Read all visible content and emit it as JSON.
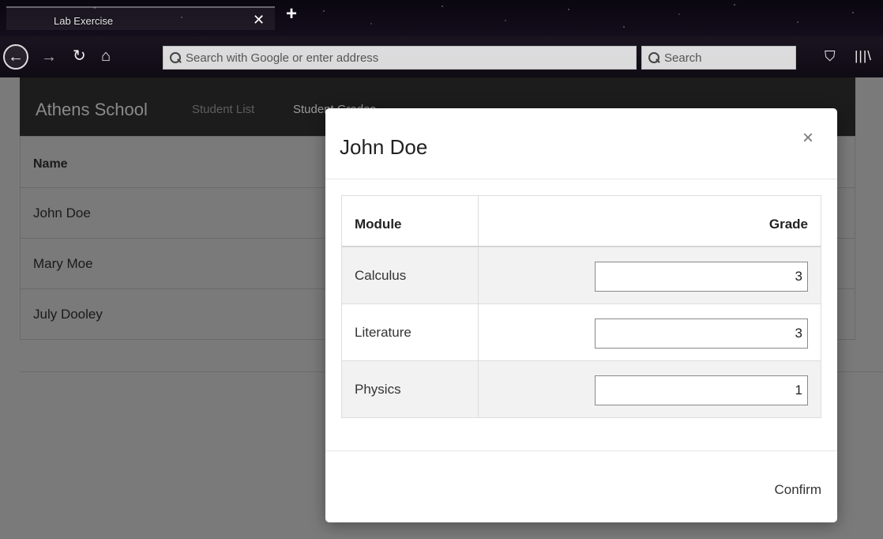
{
  "browser": {
    "tab_title": "Lab Exercise",
    "tab_close": "✕",
    "new_tab": "+",
    "url_placeholder": "Search with Google or enter address",
    "search_placeholder": "Search",
    "icons": [
      "back-icon",
      "forward-icon",
      "reload-icon",
      "home-icon",
      "pocket-icon",
      "library-icon",
      "search-icon"
    ]
  },
  "app": {
    "brand": "Athens School",
    "nav_links": [
      "Student List",
      "Student Grades"
    ],
    "table_header": {
      "name": "Name"
    },
    "students": [
      "John Doe",
      "Mary Moe",
      "July Dooley"
    ]
  },
  "modal": {
    "title": "John Doe",
    "close": "×",
    "header_module": "Module",
    "header_grade": "Grade",
    "rows": [
      {
        "module": "Calculus",
        "grade": "3"
      },
      {
        "module": "Literature",
        "grade": "3"
      },
      {
        "module": "Physics",
        "grade": "1"
      }
    ],
    "confirm_label": "Confirm"
  }
}
